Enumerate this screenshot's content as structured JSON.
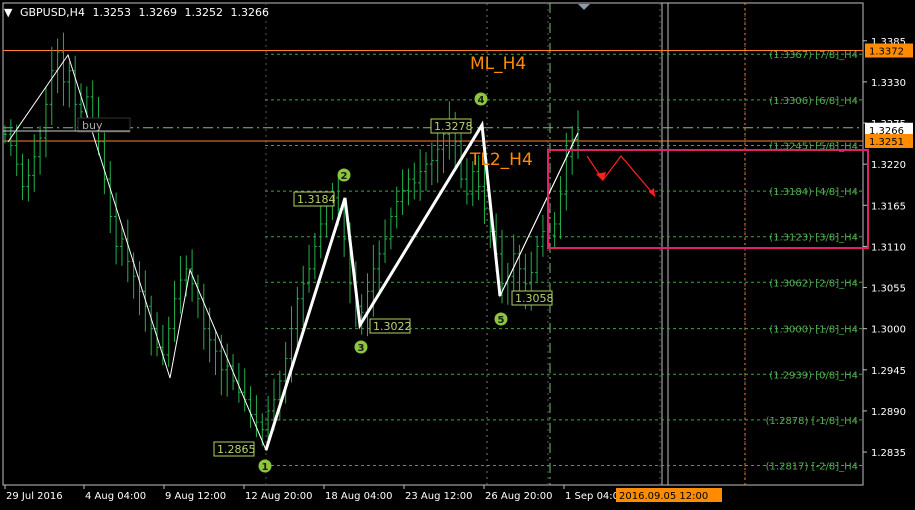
{
  "header": {
    "symbol": "GBPUSD,H4",
    "open": "1.3253",
    "high": "1.3269",
    "low": "1.3252",
    "close": "1.3266"
  },
  "colors": {
    "background": "#000000",
    "candle": "#22b14c",
    "murrey_line": "#4a9c4a",
    "price_line": "#ff8030",
    "price_tag": "#ff8c00",
    "zz_label_border": "#b0d060",
    "wave_circle": "#8cc63f",
    "box": "#e0206a",
    "arrow": "#ff2020",
    "text_orange": "#ff8c00"
  },
  "chart_data": {
    "type": "candlestick",
    "title": "GBPUSD,H4",
    "ylim": [
      1.28,
      1.342
    ],
    "y_ticks": [
      "1.3385",
      "1.3330",
      "1.3275",
      "1.3220",
      "1.3165",
      "1.3110",
      "1.3055",
      "1.3000",
      "1.2945",
      "1.2890",
      "1.2835"
    ],
    "x_ticks": [
      "29 Jul 2016",
      "4 Aug 04:00",
      "9 Aug 12:00",
      "12 Aug 20:00",
      "18 Aug 04:00",
      "23 Aug 12:00",
      "26 Aug 20:00",
      "1 Sep 04:00"
    ],
    "cursor_time_label": "2016.09.05 12:00",
    "current_price": "1.3266",
    "price_lines": [
      {
        "value": 1.3372,
        "label": "1.3372"
      },
      {
        "value": 1.3251,
        "label": "1.3251"
      }
    ],
    "murrey_levels": [
      {
        "value": 1.3367,
        "label": "(1.3367) [7/8]_H4"
      },
      {
        "value": 1.3306,
        "label": "(1.3306) [6/8]_H4"
      },
      {
        "value": 1.3245,
        "label": "(1.3245) [5/8]_H4"
      },
      {
        "value": 1.3184,
        "label": "(1.3184) [4/8]_H4"
      },
      {
        "value": 1.3123,
        "label": "(1.3123) [3/8]_H4"
      },
      {
        "value": 1.3062,
        "label": "(1.3062) [2/8]_H4"
      },
      {
        "value": 1.3,
        "label": "(1.3000) [1/8]_H4"
      },
      {
        "value": 1.2939,
        "label": "(1.2939) [0/8]_H4"
      },
      {
        "value": 1.2878,
        "label": "(1.2878) [-1/8]_H4"
      },
      {
        "value": 1.2817,
        "label": "(1.2817) [-2/8]_H4"
      }
    ],
    "zigzag_labels": [
      {
        "text": "1.2865",
        "value": 1.2865
      },
      {
        "text": "1.3184",
        "value": 1.3184
      },
      {
        "text": "1.3022",
        "value": 1.3022
      },
      {
        "text": "1.3278",
        "value": 1.3278
      },
      {
        "text": "1.3058",
        "value": 1.3058
      }
    ],
    "wave_numbers": [
      "1",
      "2",
      "3",
      "4",
      "5"
    ],
    "annotations": {
      "ml": "ML_H4",
      "tl2": "TL2_H4",
      "buy": "buy"
    },
    "candles_close": [
      1.326,
      1.3245,
      1.322,
      1.319,
      1.3205,
      1.323,
      1.3255,
      1.33,
      1.3345,
      1.337,
      1.333,
      1.3345,
      1.33,
      1.329,
      1.331,
      1.328,
      1.325,
      1.32,
      1.315,
      1.311,
      1.312,
      1.309,
      1.307,
      1.305,
      1.303,
      1.3,
      1.2975,
      1.2965,
      1.3,
      1.304,
      1.3065,
      1.308,
      1.306,
      1.304,
      1.3,
      1.2985,
      1.297,
      1.2945,
      1.295,
      1.293,
      1.2915,
      1.2905,
      1.2885,
      1.2875,
      1.2865,
      1.289,
      1.2905,
      1.293,
      1.296,
      1.3,
      1.304,
      1.306,
      1.308,
      1.311,
      1.314,
      1.3165,
      1.3175,
      1.316,
      1.312,
      1.306,
      1.303,
      1.3022,
      1.305,
      1.308,
      1.31,
      1.312,
      1.315,
      1.317,
      1.3185,
      1.32,
      1.3195,
      1.321,
      1.322,
      1.3225,
      1.324,
      1.326,
      1.3278,
      1.325,
      1.32,
      1.318,
      1.321,
      1.319,
      1.316,
      1.313,
      1.31,
      1.306,
      1.307,
      1.31,
      1.308,
      1.306,
      1.3075,
      1.311,
      1.313,
      1.3125,
      1.314,
      1.318,
      1.323,
      1.3253,
      1.3266
    ]
  }
}
